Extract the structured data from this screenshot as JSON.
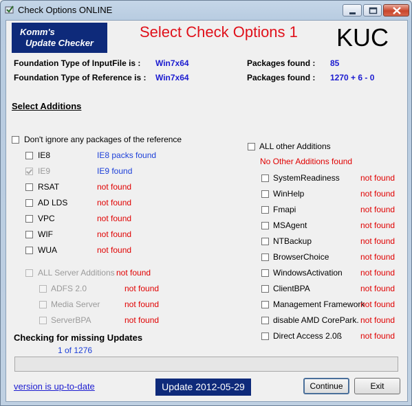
{
  "window": {
    "title": "Check Options   ONLINE"
  },
  "header": {
    "logo_line1": "Komm's",
    "logo_line2": "Update Checker",
    "title": "Select Check Options 1",
    "short": "KUC"
  },
  "info": {
    "foundation_input_label": "Foundation Type of InputFile is :",
    "foundation_input_value": "Win7x64",
    "foundation_ref_label": "Foundation Type of Reference is :",
    "foundation_ref_value": "Win7x64",
    "packages_found_label_1": "Packages found :",
    "packages_found_value_1": "85",
    "packages_found_label_2": "Packages found :",
    "packages_found_value_2": "1270 + 6 - 0"
  },
  "select_additions": "Select Additions",
  "dont_ignore": "Don't ignore any packages of the reference",
  "left_items": [
    {
      "label": "IE8",
      "status": "IE8 packs found",
      "status_color": "blue",
      "checked": false,
      "disabled": false
    },
    {
      "label": "IE9",
      "status": "IE9 found",
      "status_color": "blue",
      "checked": true,
      "disabled": true
    },
    {
      "label": "RSAT",
      "status": "not found",
      "status_color": "red",
      "checked": false,
      "disabled": false
    },
    {
      "label": "AD LDS",
      "status": "not found",
      "status_color": "red",
      "checked": false,
      "disabled": false
    },
    {
      "label": "VPC",
      "status": "not found",
      "status_color": "red",
      "checked": false,
      "disabled": false
    },
    {
      "label": "WIF",
      "status": "not found",
      "status_color": "red",
      "checked": false,
      "disabled": false
    },
    {
      "label": "WUA",
      "status": "not found",
      "status_color": "red",
      "checked": false,
      "disabled": false
    }
  ],
  "server": {
    "label": "ALL Server Additions",
    "status": "not found",
    "items": [
      {
        "label": "ADFS 2.0",
        "status": "not found"
      },
      {
        "label": "Media Server",
        "status": "not found"
      },
      {
        "label": "ServerBPA",
        "status": "not found"
      }
    ]
  },
  "other": {
    "label": "ALL other  Additions",
    "status": "No Other Additions found",
    "items": [
      {
        "label": "SystemReadiness",
        "status": "not found"
      },
      {
        "label": "WinHelp",
        "status": "not found"
      },
      {
        "label": "Fmapi",
        "status": "not found"
      },
      {
        "label": "MSAgent",
        "status": "not found"
      },
      {
        "label": "NTBackup",
        "status": "not found"
      },
      {
        "label": "BrowserChoice",
        "status": "not found"
      },
      {
        "label": "WindowsActivation",
        "status": "not found"
      },
      {
        "label": "ClientBPA",
        "status": "not found"
      },
      {
        "label": "Management Framework",
        "status": "not found"
      },
      {
        "label": "disable AMD CorePark.",
        "status": "not found"
      },
      {
        "label": "Direct Access 2.0ß",
        "status": "not found"
      }
    ]
  },
  "progress": {
    "heading": "Checking for missing Updates",
    "count": "1 of 1276",
    "fraction": 0.0
  },
  "footer": {
    "version_link": "version is up-to-date",
    "update_badge": "Update 2012-05-29",
    "continue": "Continue",
    "exit": "Exit"
  },
  "colors": {
    "red": "#e00000",
    "blue": "#1b3ed8",
    "navy": "#0e2a7a"
  }
}
